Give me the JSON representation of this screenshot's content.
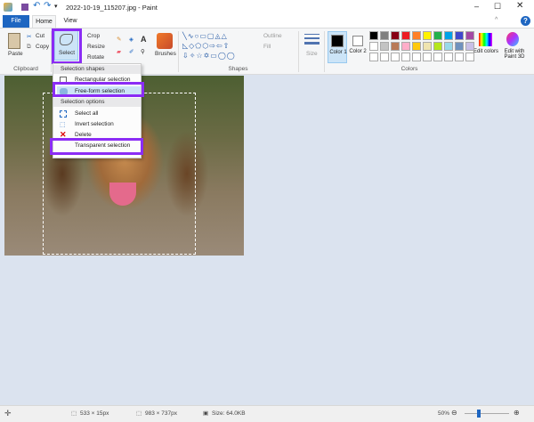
{
  "title": "2022-10-19_115207.jpg - Paint",
  "tabs": {
    "file": "File",
    "home": "Home",
    "view": "View"
  },
  "clipboard": {
    "paste": "Paste",
    "cut": "Cut",
    "copy": "Copy",
    "group": "Clipboard"
  },
  "image": {
    "select": "Select",
    "crop": "Crop",
    "resize": "Resize",
    "rotate": "Rotate"
  },
  "tools": {
    "brushes": "Brushes"
  },
  "shapes": {
    "outline": "Outline",
    "fill": "Fill",
    "group": "Shapes"
  },
  "size": "Size",
  "colors": {
    "color1": "Color 1",
    "color2": "Color 2",
    "edit": "Edit colors",
    "paint3d": "Edit with Paint 3D",
    "group": "Colors",
    "row1": [
      "#000000",
      "#7f7f7f",
      "#880015",
      "#ed1c24",
      "#ff7f27",
      "#fff200",
      "#22b14c",
      "#00a2e8",
      "#3f48cc",
      "#a349a4"
    ],
    "row2": [
      "#ffffff",
      "#c3c3c3",
      "#b97a57",
      "#ffaec9",
      "#ffc90e",
      "#efe4b0",
      "#b5e61d",
      "#99d9ea",
      "#7092be",
      "#c8bfe7"
    ],
    "accent": "#8b2cf5"
  },
  "menu": {
    "shapes_header": "Selection shapes",
    "rect": "Rectangular selection",
    "freeform": "Free-form selection",
    "options_header": "Selection options",
    "select_all": "Select all",
    "invert": "Invert selection",
    "delete": "Delete",
    "transparent": "Transparent selection"
  },
  "status": {
    "selection": "533 × 15px",
    "image_size": "983 × 737px",
    "file_size": "Size: 64.0KB",
    "zoom": "50%",
    "zoom_level": 50
  }
}
